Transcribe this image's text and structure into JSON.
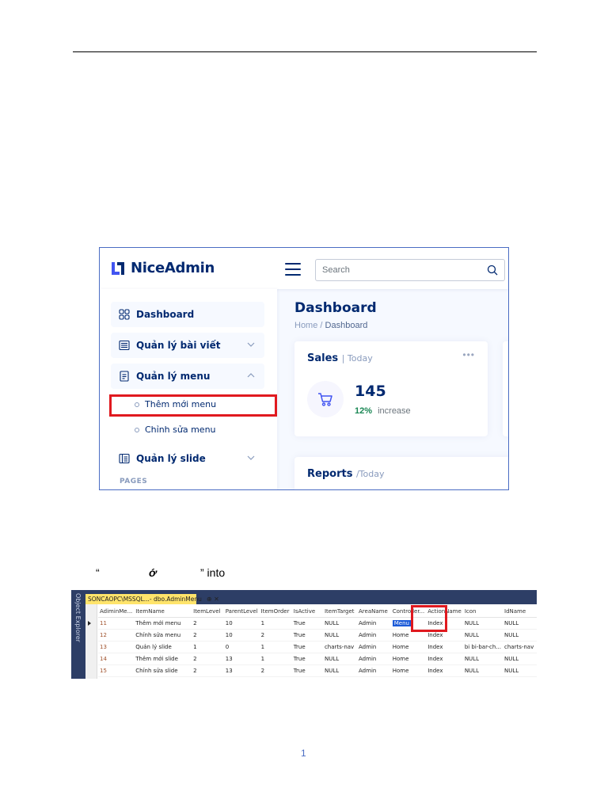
{
  "document": {
    "page_number": "1"
  },
  "mid_text": {
    "open_quote": "“",
    "middle": "ớ",
    "close": "” into"
  },
  "admin": {
    "brand": "NiceAdmin",
    "search_placeholder": "Search",
    "sidebar": {
      "items": [
        {
          "label": "Dashboard"
        },
        {
          "label": "Quản lý bài viết"
        },
        {
          "label": "Quản lý menu"
        },
        {
          "label": "Quản lý slide"
        }
      ],
      "sub_items": [
        {
          "label": "Thêm mới menu"
        },
        {
          "label": "Chỉnh sửa menu"
        }
      ],
      "section_label": "PAGES"
    },
    "main": {
      "title": "Dashboard",
      "breadcrumb": {
        "home": "Home",
        "sep": "/",
        "current": "Dashboard"
      },
      "sales_card": {
        "title": "Sales",
        "subtitle": "| Today",
        "menu": "•••",
        "value": "145",
        "percent": "12%",
        "label": "increase"
      },
      "reports_card": {
        "title": "Reports",
        "subtitle": "/Today"
      }
    },
    "colors": {
      "accent": "#012970",
      "highlight": "#e0191f",
      "success": "#198754"
    }
  },
  "ssms": {
    "object_explorer_label": "Object Explorer",
    "tab_title": "SONCAOPC\\MSSQL...- dbo.AdminMenu",
    "tab_pin": "⊕",
    "tab_close": "✕",
    "columns": [
      "AdiminMe...",
      "ItemName",
      "ItemLevel",
      "ParentLevel",
      "ItemOrder",
      "IsActive",
      "ItemTarget",
      "AreaName",
      "Controller...",
      "ActionName",
      "Icon",
      "IdName"
    ],
    "rows": [
      [
        "11",
        "Thêm mới menu",
        "2",
        "10",
        "1",
        "True",
        "NULL",
        "Admin",
        "Menu",
        "Index",
        "NULL",
        "NULL"
      ],
      [
        "12",
        "Chỉnh sửa menu",
        "2",
        "10",
        "2",
        "True",
        "NULL",
        "Admin",
        "Home",
        "Index",
        "NULL",
        "NULL"
      ],
      [
        "13",
        "Quản lý slide",
        "1",
        "0",
        "1",
        "True",
        "charts-nav",
        "Admin",
        "Home",
        "Index",
        "bi bi-bar-ch...",
        "charts-nav"
      ],
      [
        "14",
        "Thêm mới slide",
        "2",
        "13",
        "1",
        "True",
        "NULL",
        "Admin",
        "Home",
        "Index",
        "NULL",
        "NULL"
      ],
      [
        "15",
        "Chỉnh sửa slide",
        "2",
        "13",
        "2",
        "True",
        "NULL",
        "Admin",
        "Home",
        "Index",
        "NULL",
        "NULL"
      ]
    ]
  }
}
